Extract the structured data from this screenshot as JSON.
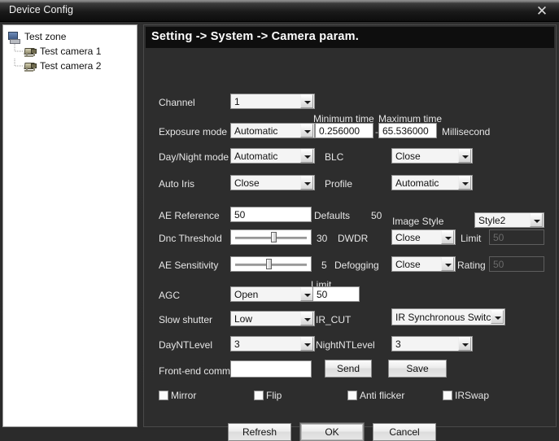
{
  "window": {
    "title": "Device Config",
    "close_icon": "close-icon"
  },
  "sidebar": {
    "nodes": [
      {
        "label": "Test zone",
        "icon": "computer-icon",
        "level": 0
      },
      {
        "label": "Test camera 1",
        "icon": "camera-icon",
        "level": 1
      },
      {
        "label": "Test camera 2",
        "icon": "camera-icon",
        "level": 1
      }
    ]
  },
  "breadcrumb": "Setting -> System -> Camera param.",
  "form": {
    "channel": {
      "label": "Channel",
      "value": "1"
    },
    "exposure_mode": {
      "label": "Exposure mode",
      "value": "Automatic"
    },
    "minimum_time": {
      "label": "Minimum time",
      "value": "0.256000"
    },
    "maximum_time": {
      "label": "Maximum time",
      "value": "65.536000"
    },
    "time_unit": "Millisecond",
    "time_separator": "-",
    "day_night_mode": {
      "label": "Day/Night mode",
      "value": "Automatic"
    },
    "blc": {
      "label": "BLC",
      "value": "Close"
    },
    "auto_iris": {
      "label": "Auto Iris",
      "value": "Close"
    },
    "profile": {
      "label": "Profile",
      "value": "Automatic"
    },
    "ae_reference": {
      "label": "AE Reference",
      "value": "50"
    },
    "defaults": {
      "label": "Defaults",
      "value": "50"
    },
    "image_style": {
      "label": "Image Style",
      "value": "Style2"
    },
    "dnc_threshold": {
      "label": "Dnc Threshold",
      "value": "30",
      "percent": 52
    },
    "dwdr": {
      "label": "DWDR",
      "value": "Close"
    },
    "dwdr_limit": {
      "label": "Limit",
      "value": "50"
    },
    "ae_sensitivity": {
      "label": "AE Sensitivity",
      "value": "5",
      "percent": 45
    },
    "defogging": {
      "label": "Defogging",
      "value": "Close"
    },
    "defogging_rating": {
      "label": "Rating",
      "value": "50"
    },
    "agc": {
      "label": "AGC",
      "value": "Open"
    },
    "agc_limit": {
      "label": "Limit",
      "value": "50"
    },
    "slow_shutter": {
      "label": "Slow shutter",
      "value": "Low"
    },
    "ir_cut": {
      "label": "IR_CUT",
      "value": "IR Synchronous Switch"
    },
    "day_nt_level": {
      "label": "DayNTLevel",
      "value": "3"
    },
    "night_nt_level": {
      "label": "NightNTLevel",
      "value": "3"
    },
    "front_end_comm": {
      "label": "Front-end comm",
      "value": ""
    },
    "send_button": "Send",
    "save_button": "Save",
    "checkboxes": [
      {
        "label": "Mirror",
        "checked": false
      },
      {
        "label": "Flip",
        "checked": false
      },
      {
        "label": "Anti flicker",
        "checked": false
      },
      {
        "label": "IRSwap",
        "checked": false
      }
    ],
    "footer_buttons": [
      {
        "label": "Refresh",
        "focused": false
      },
      {
        "label": "OK",
        "focused": true
      },
      {
        "label": "Cancel",
        "focused": false
      }
    ]
  }
}
